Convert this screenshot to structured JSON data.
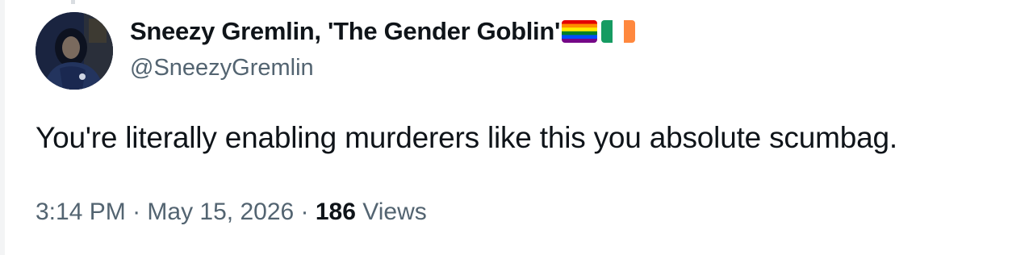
{
  "tweet": {
    "display_name": "Sneezy Gremlin, 'The Gender Goblin'",
    "handle": "@SneezyGremlin",
    "text": "You're literally enabling murderers like this you absolute scumbag.",
    "time": "3:14 PM",
    "separator": " · ",
    "date": "May 15, 2026",
    "views_count": "186",
    "views_label": "Views",
    "badges": [
      "rainbow-flag-icon",
      "ireland-flag-icon"
    ]
  },
  "colors": {
    "text_primary": "#0f1419",
    "text_secondary": "#536471",
    "background": "#ffffff"
  }
}
